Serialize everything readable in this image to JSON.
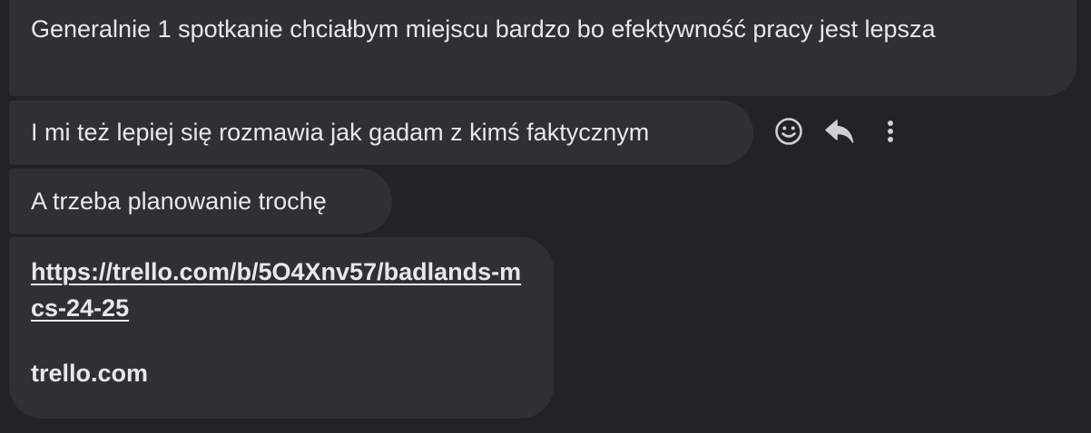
{
  "messages": [
    {
      "text": "Generalnie 1 spotkanie chciałbym miejscu bardzo bo efektywność pracy jest lepsza"
    },
    {
      "text": "I mi też lepiej się rozmawia jak gadam z kimś faktycznym"
    },
    {
      "text": "A trzeba planowanie trochę"
    },
    {
      "link": "https://trello.com/b/5O4Xnv57/badlands-mcs-24-25",
      "domain": "trello.com"
    }
  ],
  "hover_actions": [
    {
      "icon": "smiley-icon"
    },
    {
      "icon": "reply-icon"
    },
    {
      "icon": "more-vertical-icon"
    }
  ],
  "colors": {
    "background": "#232325",
    "bubble": "#303032",
    "text": "#e8e8ea",
    "icon": "#d0d0d3"
  }
}
